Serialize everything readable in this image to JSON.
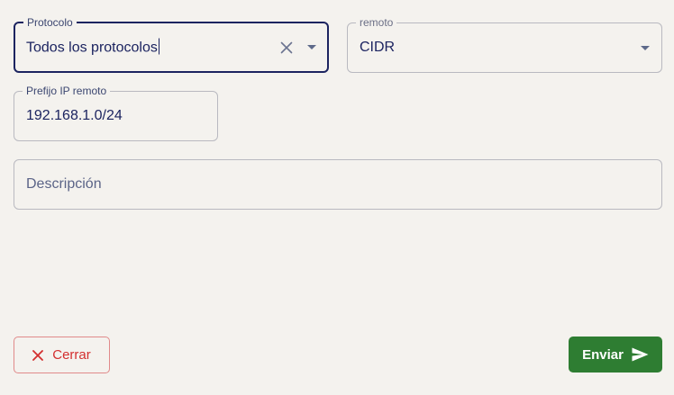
{
  "form": {
    "protocol": {
      "label": "Protocolo",
      "value": "Todos los protocolos"
    },
    "remote": {
      "label": "remoto",
      "value": "CIDR"
    },
    "remote_ip_prefix": {
      "label": "Prefijo IP remoto",
      "value": "192.168.1.0/24"
    },
    "description": {
      "placeholder": "Descripción"
    }
  },
  "actions": {
    "close_label": "Cerrar",
    "submit_label": "Enviar"
  },
  "colors": {
    "background": "#f4f2ee",
    "focused_border": "#1c2460",
    "text": "#1c2460",
    "close_accent": "#d32f2f",
    "submit_background": "#2e7d32"
  },
  "icons": {
    "clear": "close-icon",
    "dropdown": "chevron-down-icon",
    "close_button": "close-icon",
    "send": "send-icon"
  }
}
